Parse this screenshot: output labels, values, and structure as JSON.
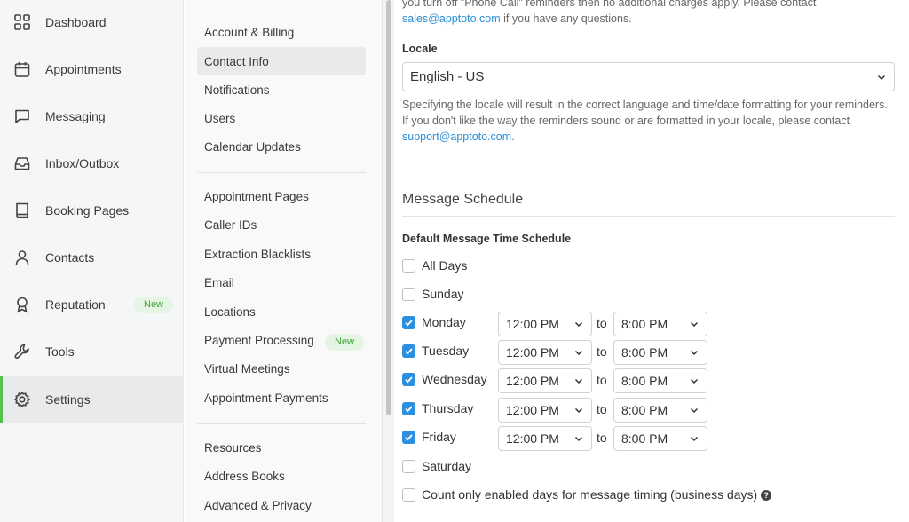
{
  "nav": {
    "items": [
      {
        "label": "Dashboard",
        "icon": "dashboard-grid-icon"
      },
      {
        "label": "Appointments",
        "icon": "calendar-icon"
      },
      {
        "label": "Messaging",
        "icon": "chat-bubble-icon"
      },
      {
        "label": "Inbox/Outbox",
        "icon": "inbox-tray-icon"
      },
      {
        "label": "Booking Pages",
        "icon": "book-icon"
      },
      {
        "label": "Contacts",
        "icon": "person-icon"
      },
      {
        "label": "Reputation",
        "icon": "award-ribbon-icon",
        "badge": "New"
      },
      {
        "label": "Tools",
        "icon": "wrench-icon"
      },
      {
        "label": "Settings",
        "icon": "gear-icon",
        "active": true
      }
    ],
    "accent_color": "#52c24b"
  },
  "submenu": {
    "group1": [
      "Account & Billing",
      "Contact Info",
      "Notifications",
      "Users",
      "Calendar Updates"
    ],
    "group2": [
      "Appointment Pages",
      "Caller IDs",
      "Extraction Blacklists",
      "Email",
      "Locations",
      "Payment Processing",
      "Virtual Meetings",
      "Appointment Payments"
    ],
    "group3": [
      "Resources",
      "Address Books",
      "Advanced & Privacy"
    ],
    "active": "Contact Info",
    "payment_badge": "New"
  },
  "main": {
    "top_text": {
      "line1": "you turn off \"Phone Call\" reminders then no additional charges apply. Please contact",
      "link": "sales@apptoto.com",
      "line2_rest": " if you have any questions."
    },
    "locale": {
      "label": "Locale",
      "value": "English - US",
      "help_line1": "Specifying the locale will result in the correct language and time/date formatting for your reminders.",
      "help_line2": "If you don't like the way the reminders sound or are formatted in your locale, please contact",
      "help_link": "support@apptoto.com",
      "help_end": "."
    },
    "schedule": {
      "title": "Message Schedule",
      "subtitle": "Default Message Time Schedule",
      "to_label": "to",
      "days": [
        {
          "label": "All Days",
          "checked": false
        },
        {
          "label": "Sunday",
          "checked": false
        },
        {
          "label": "Monday",
          "checked": true,
          "from": "12:00 PM",
          "to": "8:00 PM"
        },
        {
          "label": "Tuesday",
          "checked": true,
          "from": "12:00 PM",
          "to": "8:00 PM"
        },
        {
          "label": "Wednesday",
          "checked": true,
          "from": "12:00 PM",
          "to": "8:00 PM"
        },
        {
          "label": "Thursday",
          "checked": true,
          "from": "12:00 PM",
          "to": "8:00 PM"
        },
        {
          "label": "Friday",
          "checked": true,
          "from": "12:00 PM",
          "to": "8:00 PM"
        },
        {
          "label": "Saturday",
          "checked": false
        }
      ],
      "business_days_label": "Count only enabled days for message timing (business days)",
      "business_days_checked": false
    },
    "checkbox_color": "#2d8fe0",
    "link_color": "#2b8fd6"
  }
}
